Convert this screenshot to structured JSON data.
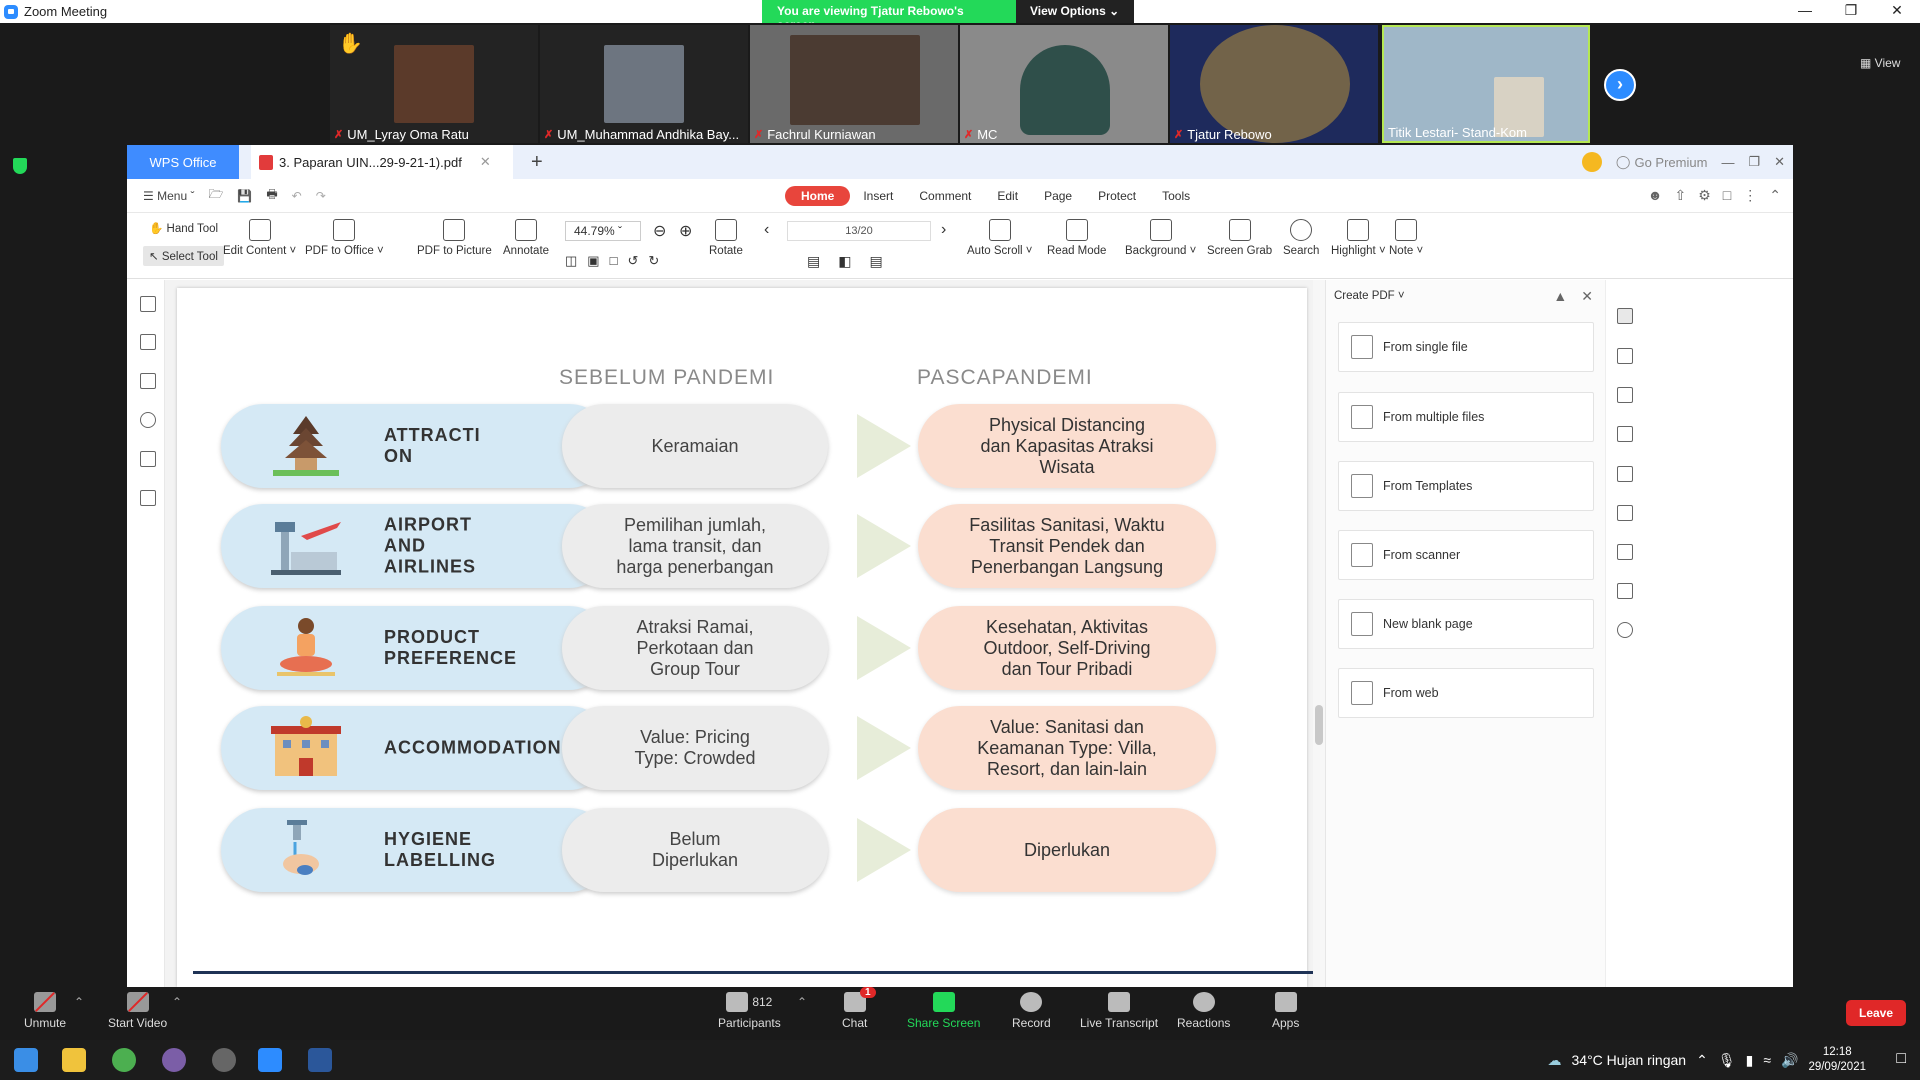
{
  "window": {
    "title": "Zoom Meeting",
    "banner": "You are viewing Tjatur Rebowo's screen",
    "view_options": "View Options ⌄",
    "view_label": "View"
  },
  "participants_strip": [
    {
      "name": "UM_Lyray Oma Ratu",
      "hand": true
    },
    {
      "name": "UM_Muhammad Andhika Bay..."
    },
    {
      "name": "Fachrul Kurniawan"
    },
    {
      "name": "MC"
    },
    {
      "name": "Tjatur Rebowo"
    },
    {
      "name": "Titik Lestari- Stand-Kom"
    }
  ],
  "wps": {
    "app_tab": "WPS Office",
    "doc_tab": "3. Paparan UIN...29-9-21-1).pdf",
    "go_premium": "Go Premium",
    "menu": "Menu",
    "tabs": [
      "Home",
      "Insert",
      "Comment",
      "Edit",
      "Page",
      "Protect",
      "Tools"
    ],
    "hand_tool": "Hand Tool",
    "select_tool": "Select Tool",
    "ribbon": {
      "edit_content": "Edit Content ˅",
      "pdf_to_office": "PDF to Office ˅",
      "pdf_to_picture": "PDF to Picture",
      "annotate": "Annotate",
      "zoom": "44.79%",
      "rotate": "Rotate",
      "page": "13/20",
      "auto_scroll": "Auto Scroll ˅",
      "read_mode": "Read Mode",
      "background": "Background ˅",
      "screen_grab": "Screen Grab",
      "search": "Search",
      "highlight": "Highlight ˅",
      "note": "Note ˅"
    },
    "slide": {
      "col_before": "SEBELUM PANDEMI",
      "col_after": "PASCAPANDEMI",
      "rows": [
        {
          "category": "ATTRACTI\nON",
          "before": "Keramaian",
          "after": "Physical Distancing\ndan Kapasitas Atraksi\nWisata"
        },
        {
          "category": "AIRPORT\nAND\nAIRLINES",
          "before": "Pemilihan jumlah,\nlama transit, dan\nharga  penerbangan",
          "after": "Fasilitas Sanitasi, Waktu\nTransit Pendek dan\nPenerbangan Langsung"
        },
        {
          "category": "PRODUCT\nPREFERENCE",
          "before": "Atraksi Ramai,\nPerkotaan dan\nGroup Tour",
          "after": "Kesehatan, Aktivitas\nOutdoor, Self-Driving\ndan  Tour Pribadi"
        },
        {
          "category": "ACCOMMODATION",
          "before": "Value: Pricing\nType: Crowded",
          "after": "Value: Sanitasi dan\nKeamanan  Type: Villa,\nResort, dan lain-lain"
        },
        {
          "category": "HYGIENE\nLABELLING",
          "before": "Belum\nDiperlukan",
          "after": "Diperlukan"
        }
      ]
    },
    "create_pdf": {
      "header": "Create PDF ˅",
      "items": [
        "From single file",
        "From multiple files",
        "From Templates",
        "From scanner",
        "New blank page",
        "From web"
      ]
    }
  },
  "controls": {
    "unmute": "Unmute",
    "start_video": "Start Video",
    "participants": "Participants",
    "participant_count": "812",
    "chat": "Chat",
    "chat_badge": "1",
    "share_screen": "Share Screen",
    "record": "Record",
    "live_transcript": "Live Transcript",
    "reactions": "Reactions",
    "apps": "Apps",
    "leave": "Leave"
  },
  "taskbar": {
    "weather": "34°C  Hujan ringan",
    "time": "12:18",
    "date": "29/09/2021"
  }
}
